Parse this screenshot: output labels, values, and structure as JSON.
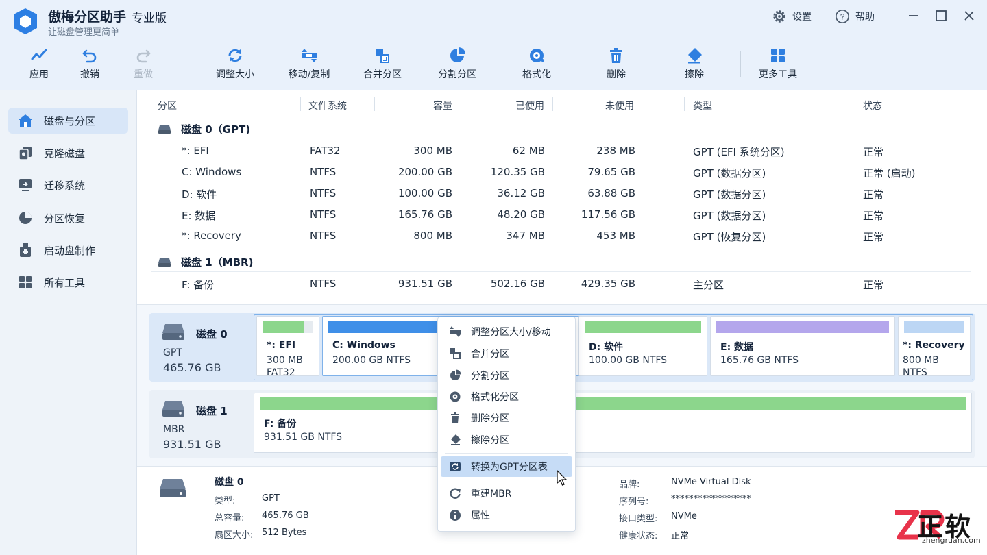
{
  "app": {
    "name": "傲梅分区助手",
    "edition": "专业版",
    "slogan": "让磁盘管理更简单",
    "settings_label": "设置",
    "help_label": "帮助"
  },
  "toolbar": {
    "apply": "应用",
    "undo": "撤销",
    "redo": "重做",
    "resize": "调整大小",
    "move_copy": "移动/复制",
    "merge": "合并分区",
    "split": "分割分区",
    "format": "格式化",
    "delete": "删除",
    "wipe": "擦除",
    "more_tools": "更多工具"
  },
  "sidebar": {
    "items": [
      {
        "label": "磁盘与分区"
      },
      {
        "label": "克隆磁盘"
      },
      {
        "label": "迁移系统"
      },
      {
        "label": "分区恢复"
      },
      {
        "label": "启动盘制作"
      },
      {
        "label": "所有工具"
      }
    ]
  },
  "table": {
    "headers": [
      "分区",
      "文件系统",
      "容量",
      "已使用",
      "未使用",
      "类型",
      "状态"
    ],
    "disks": [
      {
        "title": "磁盘 0（GPT)",
        "rows": [
          [
            "*: EFI",
            "FAT32",
            "300 MB",
            "62 MB",
            "238 MB",
            "GPT (EFI 系统分区)",
            "正常"
          ],
          [
            "C:  Windows",
            "NTFS",
            "200.00 GB",
            "120.35 GB",
            "79.65 GB",
            "GPT (数据分区)",
            "正常 (启动)"
          ],
          [
            "D:  软件",
            "NTFS",
            "100.00 GB",
            "36.12 GB",
            "63.88 GB",
            "GPT (数据分区)",
            "正常"
          ],
          [
            "E:  数据",
            "NTFS",
            "165.76 GB",
            "48.20 GB",
            "117.56 GB",
            "GPT (数据分区)",
            "正常"
          ],
          [
            "*:  Recovery",
            "NTFS",
            "800 MB",
            "347 MB",
            "453 MB",
            "GPT (恢复分区)",
            "正常"
          ]
        ]
      },
      {
        "title": "磁盘 1（MBR)",
        "rows": [
          [
            "F:  备份",
            "NTFS",
            "931.51 GB",
            "502.16 GB",
            "429.35 GB",
            "主分区",
            "正常"
          ]
        ]
      }
    ]
  },
  "diskmap": {
    "disk0": {
      "name": "磁盘 0",
      "style": "GPT",
      "size": "465.76 GB",
      "partitions": [
        {
          "name": "*: EFI",
          "detail": "300 MB",
          "detail2": "FAT32",
          "used_fraction": 0.82,
          "color": "#8cd68c"
        },
        {
          "name": "C:  Windows",
          "detail": "200.00 GB NTFS",
          "used_fraction": 0.62,
          "color": "#3f8fe8"
        },
        {
          "name": "D:  软件",
          "detail": "100.00 GB NTFS",
          "used_fraction": 1.0,
          "color": "#8cd68c"
        },
        {
          "name": "E:  数据",
          "detail": "165.76 GB NTFS",
          "used_fraction": 1.0,
          "color": "#b4a6ec"
        },
        {
          "name": "*:  Recovery",
          "detail": "800 MB",
          "detail2": "NTFS",
          "used_fraction": 1.0,
          "color": "#bcd6f4"
        }
      ]
    },
    "disk1": {
      "name": "磁盘 1",
      "style": "MBR",
      "size": "931.51 GB",
      "partitions": [
        {
          "name": "F:  备份",
          "detail": "931.51 GB NTFS",
          "used_fraction": 1.0,
          "color": "#8cd68c"
        }
      ]
    }
  },
  "context_menu": {
    "items": [
      {
        "label": "调整分区大小/移动",
        "icon": "resize-move-icon"
      },
      {
        "label": "合并分区",
        "icon": "merge-icon"
      },
      {
        "label": "分割分区",
        "icon": "split-icon"
      },
      {
        "label": "格式化分区",
        "icon": "format-icon"
      },
      {
        "label": "删除分区",
        "icon": "trash-icon"
      },
      {
        "label": "擦除分区",
        "icon": "eraser-icon"
      },
      {
        "label": "转换为GPT分区表",
        "icon": "convert-gpt-icon"
      },
      {
        "label": "重建MBR",
        "icon": "rebuild-icon"
      },
      {
        "label": "属性",
        "icon": "info-icon"
      }
    ]
  },
  "info": {
    "title": "磁盘 0",
    "type_label": "类型:",
    "type_value": "GPT",
    "capacity_label": "总容量:",
    "capacity_value": "465.76 GB",
    "sector_label": "扇区大小:",
    "sector_value": "512 Bytes",
    "brand_label": "品牌:",
    "brand_value": "NVMe Virtual Disk",
    "serial_label": "序列号:",
    "serial_value": "******************",
    "interface_label": "接口类型:",
    "interface_value": "NVMe",
    "health_label": "健康状态:",
    "health_value": "正常"
  },
  "watermark": {
    "logo_text": "ZR",
    "brand": "正软",
    "url": "zhengruan.com"
  },
  "colors": {
    "accent": "#2f7fe0",
    "green": "#8cd68c",
    "purple": "#b4a6ec",
    "highlight": "#c6dcf6"
  }
}
